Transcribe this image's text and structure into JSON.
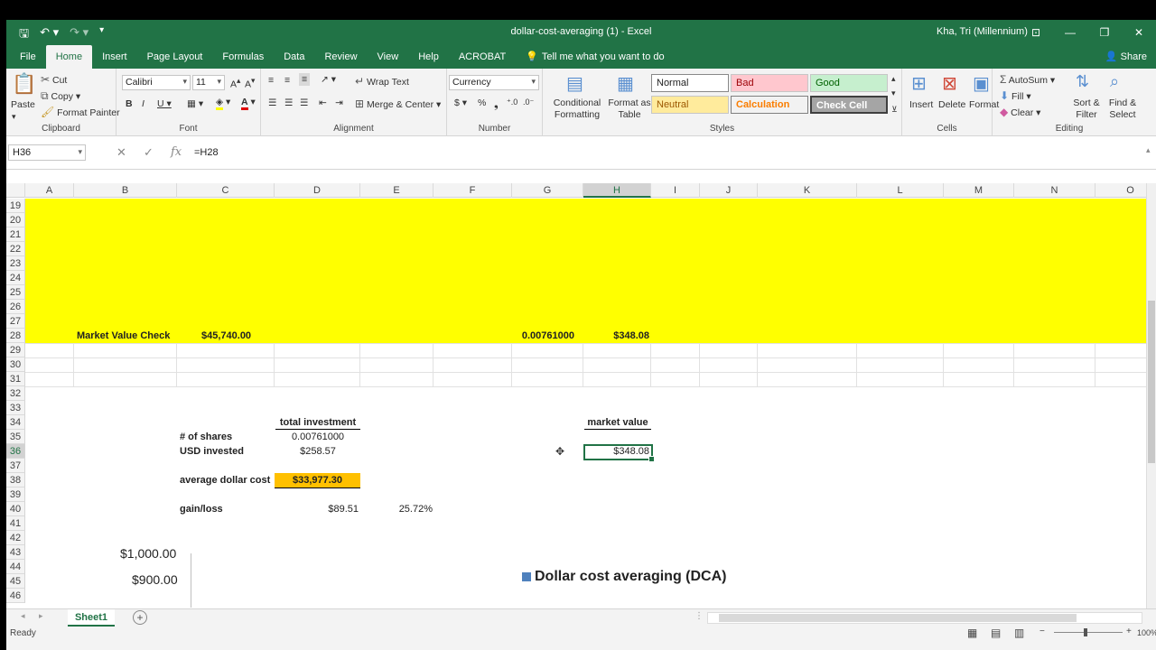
{
  "window": {
    "title": "dollar-cost-averaging (1)  -  Excel",
    "user": "Kha, Tri (Millennium)"
  },
  "tabs": [
    "File",
    "Home",
    "Insert",
    "Page Layout",
    "Formulas",
    "Data",
    "Review",
    "View",
    "Help",
    "ACROBAT"
  ],
  "tell_me": "Tell me what you want to do",
  "share_label": "Share",
  "ribbon": {
    "clipboard": {
      "paste": "Paste",
      "cut": "Cut",
      "copy": "Copy",
      "format_painter": "Format Painter",
      "label": "Clipboard"
    },
    "font": {
      "name": "Calibri",
      "size": "11",
      "label": "Font"
    },
    "alignment": {
      "wrap": "Wrap Text",
      "merge": "Merge & Center",
      "label": "Alignment"
    },
    "number": {
      "format": "Currency",
      "label": "Number"
    },
    "styles": {
      "conditional": "Conditional Formatting",
      "format_table": "Format as Table",
      "normal": "Normal",
      "bad": "Bad",
      "good": "Good",
      "neutral": "Neutral",
      "calculation": "Calculation",
      "check": "Check Cell",
      "label": "Styles"
    },
    "cells": {
      "insert": "Insert",
      "delete": "Delete",
      "format": "Format",
      "label": "Cells"
    },
    "editing": {
      "autosum": "AutoSum",
      "fill": "Fill",
      "clear": "Clear",
      "sort": "Sort & Filter",
      "find": "Find & Select",
      "label": "Editing"
    }
  },
  "formula_bar": {
    "name_box": "H36",
    "formula": "=H28"
  },
  "columns": [
    "A",
    "B",
    "C",
    "D",
    "E",
    "F",
    "G",
    "H",
    "I",
    "J",
    "K",
    "L",
    "M",
    "N",
    "O"
  ],
  "rows": [
    "19",
    "20",
    "21",
    "22",
    "23",
    "24",
    "25",
    "26",
    "27",
    "28",
    "29",
    "30",
    "31",
    "32",
    "33",
    "34",
    "35",
    "36",
    "37",
    "38",
    "39",
    "40",
    "41",
    "42",
    "43",
    "44",
    "45",
    "46"
  ],
  "cells": {
    "b28": "Market Value Check",
    "c28": "$45,740.00",
    "g28": "0.00761000",
    "h28": "$348.08",
    "d34": "total investment",
    "h34": "market value",
    "b35": "# of shares",
    "d35": "0.00761000",
    "b36": "USD invested",
    "d36": "$258.57",
    "h36": "$348.08",
    "b38": "average dollar cost",
    "d38": "$33,977.30",
    "b40": "gain/loss",
    "d40": "$89.51",
    "e40": "25.72%"
  },
  "chart": {
    "tick_1000": "$1,000.00",
    "tick_900": "$900.00",
    "legend": "Dollar cost averaging (DCA)"
  },
  "sheet_tab": "Sheet1",
  "status": "Ready",
  "zoom": "100%",
  "colors": {
    "excel_green": "#217346",
    "yellow_fill": "#ffff00",
    "orange_fill": "#ffc000",
    "legend_blue": "#4f81bd"
  }
}
